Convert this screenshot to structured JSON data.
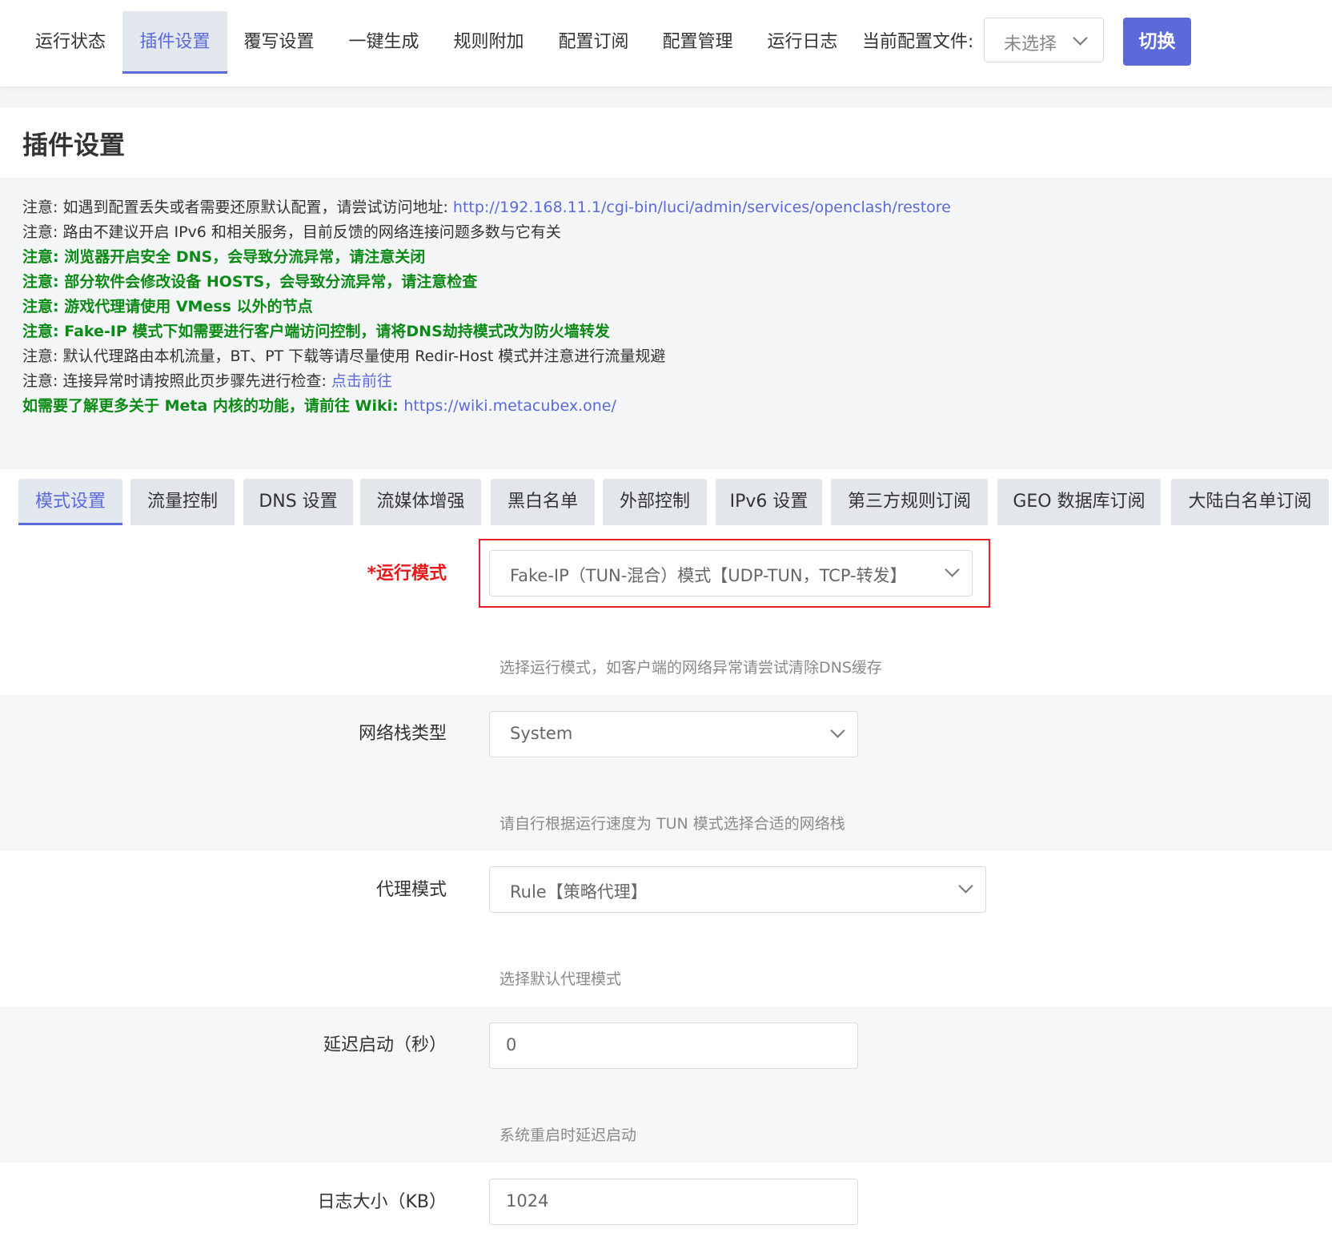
{
  "nav": {
    "items": [
      "运行状态",
      "插件设置",
      "覆写设置",
      "一键生成",
      "规则附加",
      "配置订阅",
      "配置管理",
      "运行日志"
    ],
    "active_index": 1,
    "config_label": "当前配置文件:",
    "config_value": "未选择",
    "switch_label": "切换"
  },
  "page": {
    "title": "插件设置"
  },
  "notices": [
    {
      "prefix": "注意: ",
      "text": "如遇到配置丢失或者需要还原默认配置，请尝试访问地址: ",
      "link": "http://192.168.11.1/cgi-bin/luci/admin/services/openclash/restore",
      "style": "normal"
    },
    {
      "prefix": "注意: ",
      "text": "路由不建议开启 IPv6 和相关服务，目前反馈的网络连接问题多数与它有关",
      "link": "",
      "style": "normal"
    },
    {
      "prefix": "注意: ",
      "text": "浏览器开启安全 DNS，会导致分流异常，请注意关闭",
      "link": "",
      "style": "green"
    },
    {
      "prefix": "注意: ",
      "text": "部分软件会修改设备 HOSTS，会导致分流异常，请注意检查",
      "link": "",
      "style": "green"
    },
    {
      "prefix": "注意: ",
      "text": "游戏代理请使用 VMess 以外的节点",
      "link": "",
      "style": "green"
    },
    {
      "prefix": "注意: ",
      "text": "Fake-IP 模式下如需要进行客户端访问控制，请将DNS劫持模式改为防火墙转发",
      "link": "",
      "style": "green"
    },
    {
      "prefix": "注意: ",
      "text": "默认代理路由本机流量，BT、PT 下载等请尽量使用 Redir-Host 模式并注意进行流量规避",
      "link": "",
      "style": "normal"
    },
    {
      "prefix": "注意: ",
      "text": "连接异常时请按照此页步骤先进行检查: ",
      "link": "点击前往",
      "style": "normal"
    },
    {
      "prefix": "",
      "text": "如需要了解更多关于 Meta 内核的功能，请前往 Wiki: ",
      "link": "https://wiki.metacubex.one/",
      "style": "green"
    }
  ],
  "tabs": [
    "模式设置",
    "流量控制",
    "DNS 设置",
    "流媒体增强",
    "黑白名单",
    "外部控制",
    "IPv6 设置",
    "第三方规则订阅",
    "GEO 数据库订阅",
    "大陆白名单订阅"
  ],
  "active_tab": 0,
  "form": {
    "run_mode": {
      "label": "*运行模式",
      "value": "Fake-IP（TUN-混合）模式【UDP-TUN，TCP-转发】",
      "hint": "选择运行模式，如客户端的网络异常请尝试清除DNS缓存"
    },
    "stack_type": {
      "label": "网络栈类型",
      "value": "System",
      "hint": "请自行根据运行速度为 TUN 模式选择合适的网络栈"
    },
    "proxy_mode": {
      "label": "代理模式",
      "value": "Rule【策略代理】",
      "hint": "选择默认代理模式"
    },
    "start_delay": {
      "label": "延迟启动（秒）",
      "value": "0",
      "hint": "系统重启时延迟启动"
    },
    "log_size": {
      "label": "日志大小（KB）",
      "value": "1024"
    }
  },
  "colors": {
    "accent": "#5b6ad8",
    "notice_green": "#0b8a16",
    "required_red": "#e81818",
    "highlight_border": "#e2222a"
  }
}
